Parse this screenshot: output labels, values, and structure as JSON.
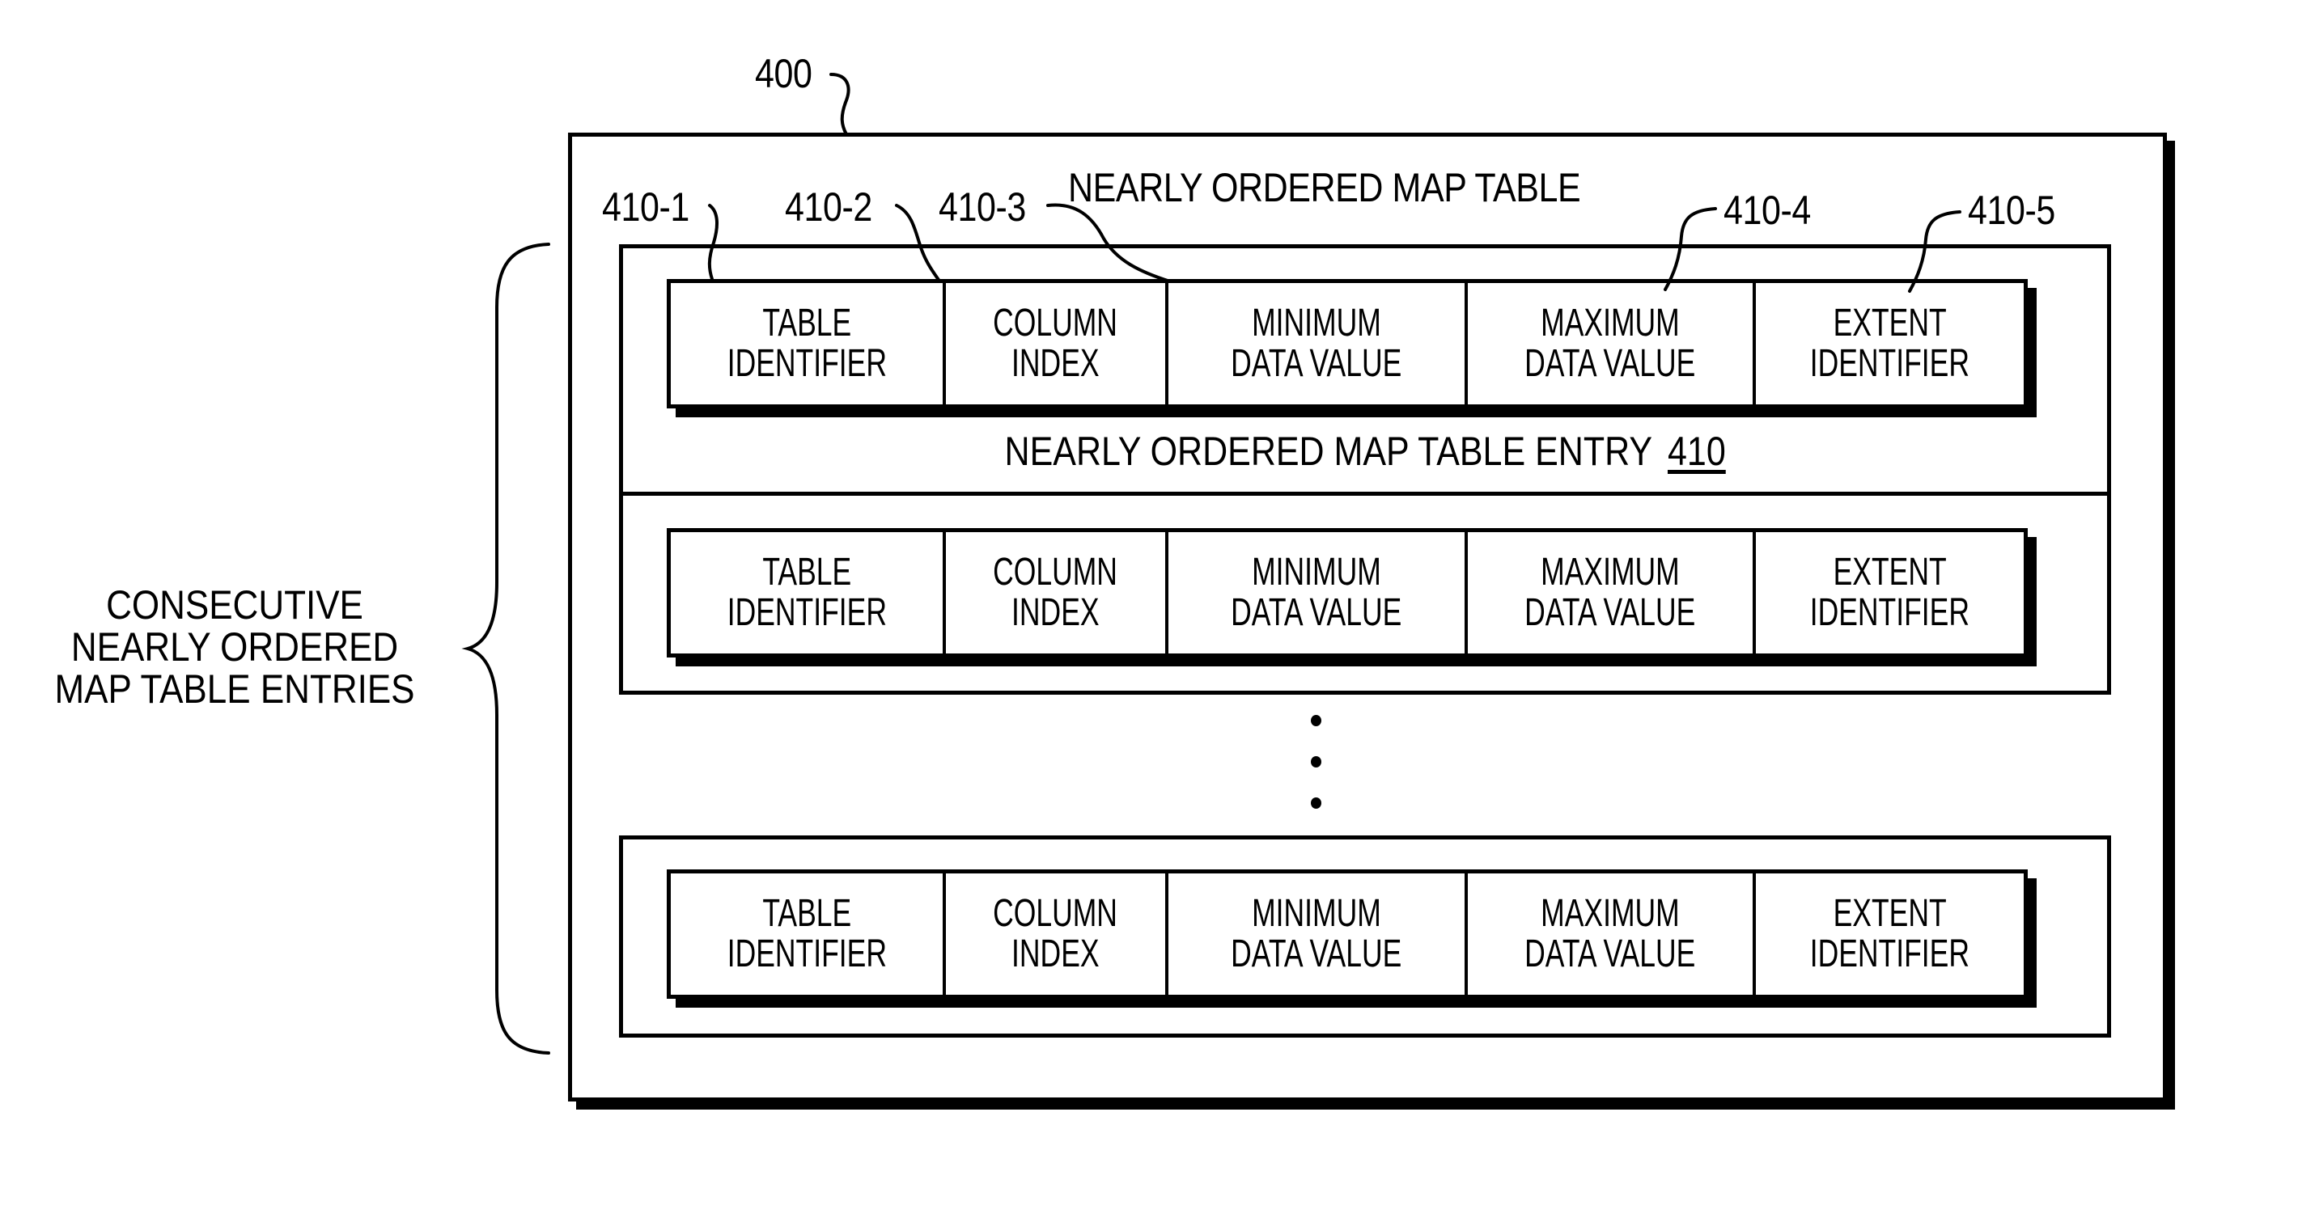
{
  "figure": {
    "reference_number": "400",
    "title": "NEARLY ORDERED MAP TABLE",
    "entry_caption": "NEARLY ORDERED MAP TABLE ENTRY",
    "entry_reference": "410",
    "side_label": [
      "CONSECUTIVE",
      "NEARLY ORDERED",
      "MAP TABLE ENTRIES"
    ],
    "field_callouts": [
      "410-1",
      "410-2",
      "410-3",
      "410-4",
      "410-5"
    ],
    "ellipsis": "vertical-dots"
  },
  "entries": [
    {
      "fields": [
        [
          "TABLE",
          "IDENTIFIER"
        ],
        [
          "COLUMN",
          "INDEX"
        ],
        [
          "MINIMUM",
          "DATA VALUE"
        ],
        [
          "MAXIMUM",
          "DATA VALUE"
        ],
        [
          "EXTENT",
          "IDENTIFIER"
        ]
      ]
    },
    {
      "fields": [
        [
          "TABLE",
          "IDENTIFIER"
        ],
        [
          "COLUMN",
          "INDEX"
        ],
        [
          "MINIMUM",
          "DATA VALUE"
        ],
        [
          "MAXIMUM",
          "DATA VALUE"
        ],
        [
          "EXTENT",
          "IDENTIFIER"
        ]
      ]
    },
    {
      "fields": [
        [
          "TABLE",
          "IDENTIFIER"
        ],
        [
          "COLUMN",
          "INDEX"
        ],
        [
          "MINIMUM",
          "DATA VALUE"
        ],
        [
          "MAXIMUM",
          "DATA VALUE"
        ],
        [
          "EXTENT",
          "IDENTIFIER"
        ]
      ]
    }
  ],
  "colors": {
    "ink": "#000000",
    "paper": "#ffffff"
  }
}
